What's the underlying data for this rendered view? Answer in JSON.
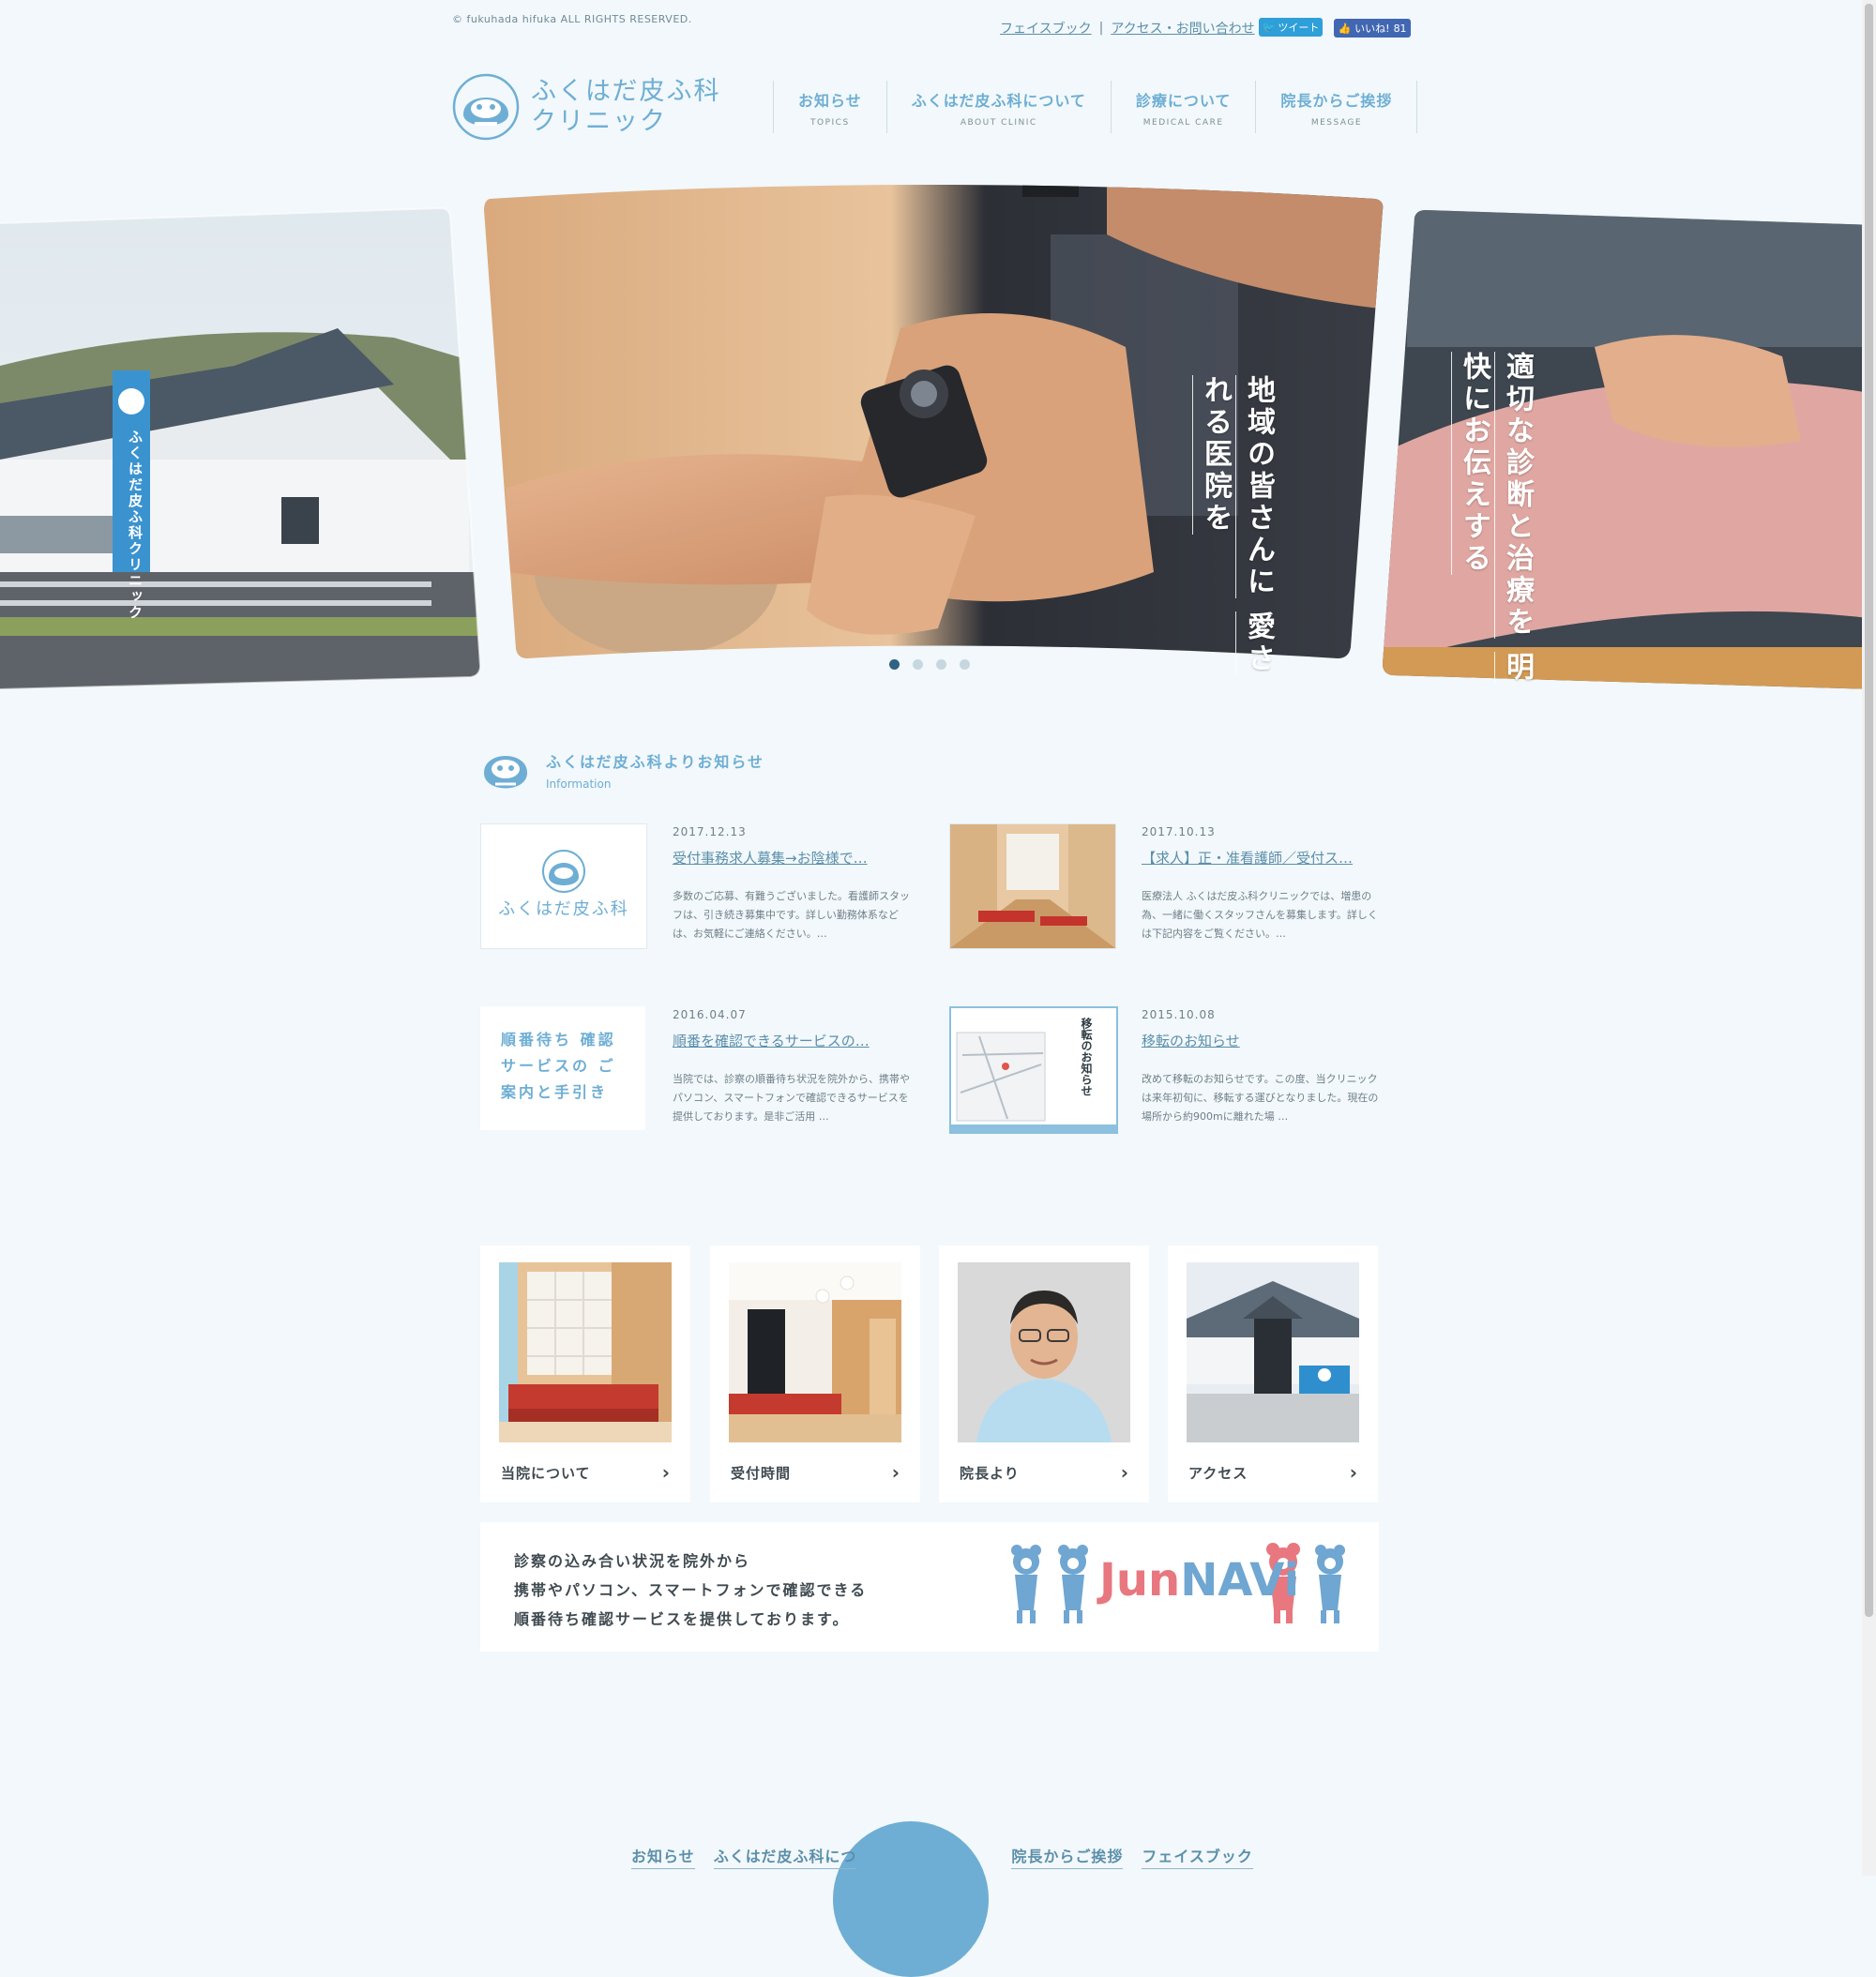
{
  "topbar": {
    "copyright": "© fukuhada hifuka ALL RIGHTS RESERVED.",
    "link_facebook": "フェイスブック",
    "separator": "|",
    "link_access": "アクセス・お問い合わせ",
    "tweet_label": "ツイート",
    "like_label": "いいね!",
    "like_count": "81"
  },
  "header": {
    "logo_line1": "ふくはだ皮ふ科",
    "logo_line2": "クリニック",
    "nav": [
      {
        "jp": "お知らせ",
        "en": "TOPICS"
      },
      {
        "jp": "ふくはだ皮ふ科について",
        "en": "ABOUT CLINIC"
      },
      {
        "jp": "診療について",
        "en": "MEDICAL CARE"
      },
      {
        "jp": "院長からご挨拶",
        "en": "MESSAGE"
      }
    ]
  },
  "slider": {
    "center_text": [
      "地域の皆さんに",
      "愛される医院を"
    ],
    "right_text": [
      "適切な診断と治療を",
      "明快にお伝えする"
    ],
    "building_sign": "ふくはだ皮ふ科クリニック",
    "slide_count": 4,
    "active_slide": 1
  },
  "news": {
    "title": "ふくはだ皮ふ科よりお知らせ",
    "subtitle": "Information",
    "items": [
      {
        "date": "2017.12.13",
        "title": "受付事務求人募集→お陰様で…",
        "excerpt": "多数のご応募、有難うございました。看護師スタッフは、引き続き募集中です。詳しい勤務体系などは、お気軽にご連絡ください。…",
        "thumb_text": "ふくはだ皮ふ科"
      },
      {
        "date": "2017.10.13",
        "title": "【求人】正・准看護師／受付ス…",
        "excerpt": "医療法人 ふくはだ皮ふ科クリニックでは、増患の為、一緒に働くスタッフさんを募集します。詳しくは下記内容をご覧ください。…",
        "thumb_text": ""
      },
      {
        "date": "2016.04.07",
        "title": "順番を確認できるサービスの…",
        "excerpt": "当院では、診察の順番待ち状況を院外から、携帯やパソコン、スマートフォンで確認できるサービスを提供しております。是非ご活用 …",
        "thumb_text": "順番待ち 確認サービスの ご案内と手引き"
      },
      {
        "date": "2015.10.08",
        "title": "移転のお知らせ",
        "excerpt": "改めて移転のお知らせです。この度、当クリニックは来年初旬に、移転する運びとなりました。現在の場所から約900mに離れた場 …",
        "thumb_text": "移転のお知らせ"
      }
    ]
  },
  "boxes": [
    {
      "label": "当院について"
    },
    {
      "label": "受付時間"
    },
    {
      "label": "院長より"
    },
    {
      "label": "アクセス"
    }
  ],
  "junnavi": {
    "text": [
      "診察の込み合い状況を院外から",
      "携帯やパソコン、スマートフォンで確認できる",
      "順番待ち確認サービスを提供しております。"
    ],
    "logo_jun": "Jun",
    "logo_navi": "NAVi"
  },
  "footer_nav": [
    "お知らせ",
    "ふくはだ皮ふ科につ",
    "院長からご挨拶",
    "フェイスブック"
  ],
  "colors": {
    "background": "#f2f8fb",
    "brand_blue": "#6eaed4",
    "link_blue": "#5b8faa",
    "jun_pink": "#e8777f",
    "tweet_blue": "#2e9fd8",
    "like_blue": "#4267b2"
  }
}
